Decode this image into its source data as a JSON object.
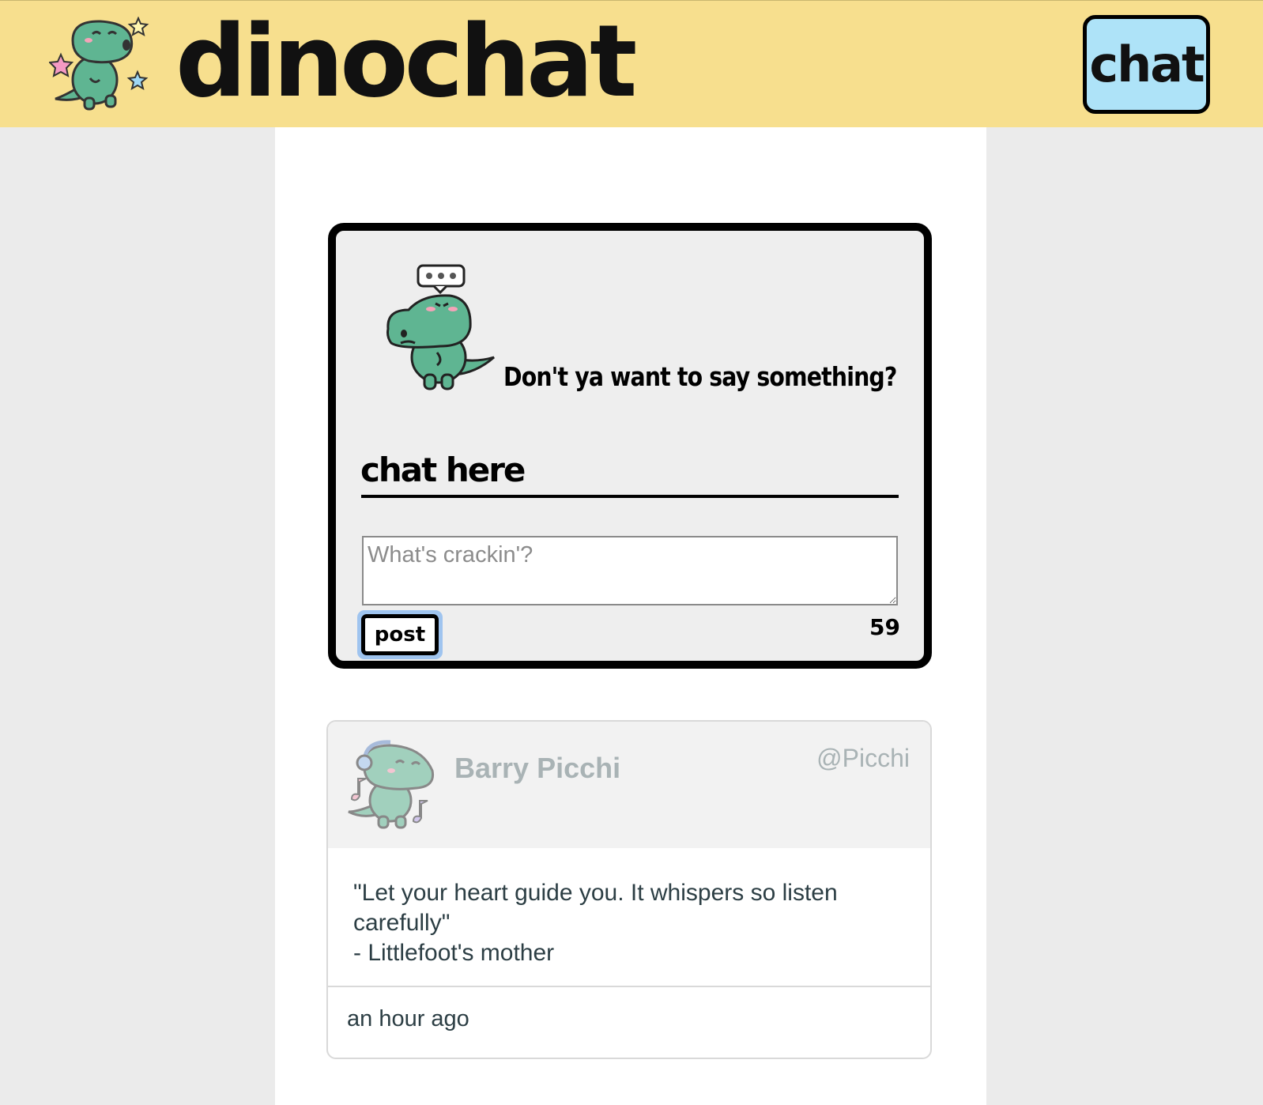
{
  "header": {
    "brand": "dinochat",
    "nav_button": "chat",
    "logo_icon": "dino-singing-icon"
  },
  "compose": {
    "prompt": "Don't ya want to say something?",
    "heading": "chat here",
    "placeholder": "What's crackin'?",
    "value": "",
    "post_label": "post",
    "char_count": "59"
  },
  "posts": [
    {
      "author": "Barry Picchi",
      "handle": "@Picchi",
      "quote_line1": "\"Let your heart guide you. It whispers so listen carefully\"",
      "quote_line2": "- Littlefoot's mother",
      "time": "an hour ago"
    }
  ],
  "colors": {
    "header_bg": "#f7df8e",
    "nav_button_bg": "#aee3f8",
    "dino_green": "#5fb592",
    "page_bg": "#ebebeb"
  }
}
